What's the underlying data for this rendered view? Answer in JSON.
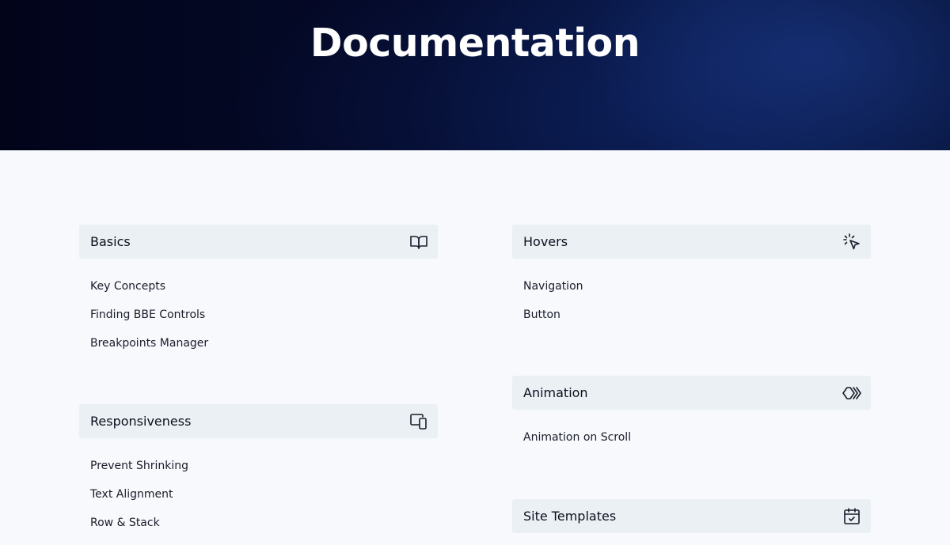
{
  "hero": {
    "title": "Documentation"
  },
  "sections": {
    "basics": {
      "title": "Basics",
      "icon": "book-icon",
      "links": [
        "Key Concepts",
        "Finding BBE Controls",
        "Breakpoints Manager"
      ]
    },
    "responsiveness": {
      "title": "Responsiveness",
      "icon": "devices-icon",
      "links": [
        "Prevent Shrinking",
        "Text Alignment",
        "Row & Stack"
      ]
    },
    "hovers": {
      "title": "Hovers",
      "icon": "cursor-click-icon",
      "links": [
        "Navigation",
        "Button"
      ]
    },
    "animation": {
      "title": "Animation",
      "icon": "chevrons-animation-icon",
      "links": [
        "Animation on Scroll"
      ]
    },
    "site_templates": {
      "title": "Site Templates",
      "icon": "calendar-check-icon",
      "links": []
    }
  },
  "colors": {
    "hero_dark": "#02041a",
    "hero_glow": "#0a1c4f",
    "page_bg": "#f7f9fc",
    "header_bg": "#ebf0f5",
    "text": "#0c0f1c"
  }
}
